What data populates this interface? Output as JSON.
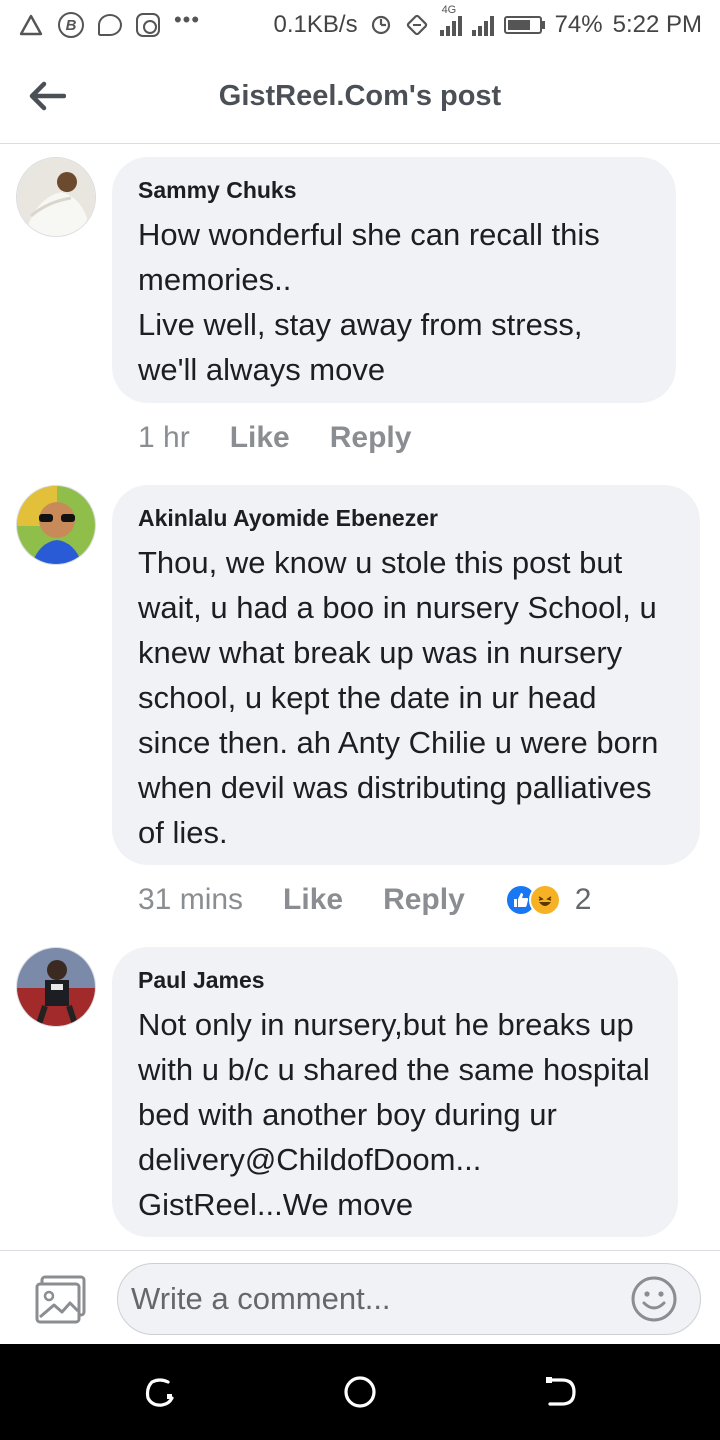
{
  "status_bar": {
    "speed": "0.1KB/s",
    "network": "4G",
    "battery_percent": "74%",
    "battery_level": 0.74,
    "time": "5:22 PM",
    "notification_icons": [
      "alert-triangle-icon",
      "bitcoin-icon",
      "messenger-icon",
      "instagram-icon"
    ]
  },
  "header": {
    "title": "GistReel.Com's post"
  },
  "comments": [
    {
      "author": "Sammy Chuks",
      "text": "How wonderful she can recall this memories..\nLive well, stay away from stress, we'll always move",
      "time": "1 hr",
      "like_label": "Like",
      "reply_label": "Reply"
    },
    {
      "author": "Akinlalu Ayomide Ebenezer",
      "text": "Thou, we know u stole this post but wait, u had a boo in nursery School, u knew what break up was in nursery school, u kept the date in ur head since then. ah Anty Chilie u were born when devil was distributing palliatives of lies.",
      "time": "31 mins",
      "like_label": "Like",
      "reply_label": "Reply",
      "reactions": [
        "like",
        "haha"
      ],
      "reaction_count": "2"
    },
    {
      "author": "Paul James",
      "text": "Not only in nursery,but he breaks up with u b/c u shared the same hospital bed with another boy during ur delivery@ChildofDoom...\nGistReel...We move"
    }
  ],
  "compose": {
    "placeholder": "Write a comment..."
  },
  "colors": {
    "bubble": "#f0f2f5",
    "meta_text": "#8a8d91",
    "like_blue": "#1877f2",
    "haha_yellow": "#f7b125"
  }
}
